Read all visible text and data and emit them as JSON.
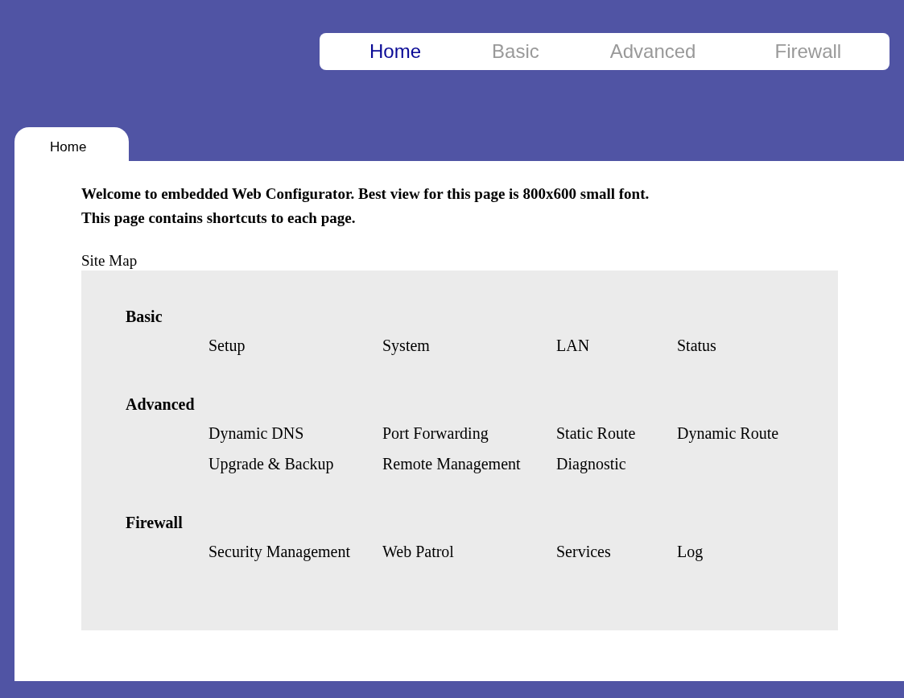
{
  "nav": [
    {
      "label": "Home",
      "selected": true
    },
    {
      "label": "Basic",
      "selected": false
    },
    {
      "label": "Advanced",
      "selected": false
    },
    {
      "label": "Firewall",
      "selected": false
    }
  ],
  "page_tab": {
    "label": "Home"
  },
  "welcome": [
    "Welcome to embedded Web Configurator. Best view for this page is 800x600 small font.",
    "This page contains shortcuts to each page."
  ],
  "site_map": {
    "title": "Site Map",
    "sections": [
      {
        "title": "Basic",
        "rows": [
          [
            "Setup",
            "System",
            "LAN",
            "Status"
          ]
        ]
      },
      {
        "title": "Advanced",
        "rows": [
          [
            "Dynamic DNS",
            "Port Forwarding",
            "Static Route",
            "Dynamic Route"
          ],
          [
            "Upgrade & Backup",
            "Remote Management",
            "Diagnostic"
          ]
        ]
      },
      {
        "title": "Firewall",
        "rows": [
          [
            "Security Management",
            "Web Patrol",
            "Services",
            "Log"
          ]
        ]
      }
    ]
  }
}
